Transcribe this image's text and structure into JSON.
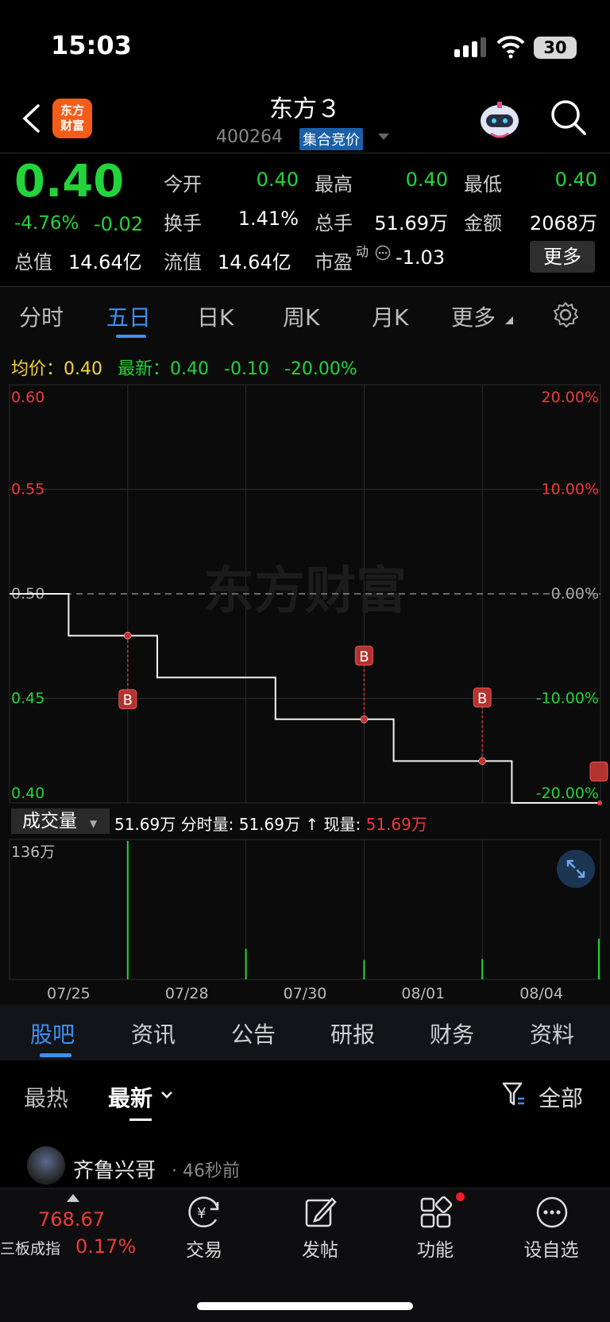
{
  "status": {
    "time": "15:03",
    "battery": "30"
  },
  "header": {
    "logo_line1": "东方",
    "logo_line2": "财富",
    "title": "东方３",
    "code": "400264",
    "badge": "集合竞价"
  },
  "quote": {
    "price": "0.40",
    "change_pct": "-4.76%",
    "change": "-0.02",
    "total_value_label": "总值",
    "total_value": "14.64亿",
    "rows": [
      [
        {
          "label": "今开",
          "value": "0.40",
          "color": "green"
        },
        {
          "label": "最高",
          "value": "0.40",
          "color": "green"
        },
        {
          "label": "最低",
          "value": "0.40",
          "color": "green"
        }
      ],
      [
        {
          "label": "换手",
          "value": "1.41%",
          "color": "white"
        },
        {
          "label": "总手",
          "value": "51.69万",
          "color": "white"
        },
        {
          "label": "金额",
          "value": "2068万",
          "color": "white"
        }
      ]
    ],
    "float_label": "流值",
    "float_value": "14.64亿",
    "pe_label": "市盈",
    "pe_sup": "动",
    "pe_value": "-1.03",
    "more_button": "更多"
  },
  "chart_tabs": [
    "分时",
    "五日",
    "日K",
    "周K",
    "月K",
    "更多"
  ],
  "chart_header": {
    "avg_label": "均价：",
    "avg_value": "0.40",
    "latest_label": "最新：",
    "latest_value": "0.40",
    "latest_change": "-0.10",
    "latest_pct": "-20.00%"
  },
  "chart_data": {
    "type": "line",
    "title": "",
    "x_tick_labels": [
      "07/25",
      "07/28",
      "07/30",
      "08/01",
      "08/04"
    ],
    "y_tick_labels": [
      "0.60",
      "0.55",
      "0.50",
      "0.45",
      "0.40"
    ],
    "y_right_labels": [
      "20.00%",
      "10.00%",
      "0.00%",
      "-10.00%",
      "-20.00%"
    ],
    "ylim": [
      0.4,
      0.6
    ],
    "prev_close": 0.5,
    "series": [
      {
        "x": [
          0,
          0.5,
          0.5,
          1.25,
          1.25,
          2.25,
          2.25,
          3.25,
          3.25,
          4.25,
          4.25,
          5.0
        ],
        "y": [
          0.5,
          0.5,
          0.48,
          0.48,
          0.46,
          0.46,
          0.44,
          0.44,
          0.42,
          0.42,
          0.4,
          0.4
        ]
      }
    ],
    "markers": [
      {
        "x": 1.0,
        "y": 0.48,
        "label": "B",
        "side": "below"
      },
      {
        "x": 3.0,
        "y": 0.44,
        "label": "B",
        "side": "above"
      },
      {
        "x": 4.0,
        "y": 0.42,
        "label": "B",
        "side": "above"
      }
    ],
    "volume": {
      "label": "成交量",
      "summary": "51.69万",
      "fen_label": "分时量:",
      "fen_value": "51.69万",
      "now_label": "现量:",
      "now_value": "51.69万",
      "max_label": "136万",
      "max": 136,
      "bars": [
        {
          "x": 1.0,
          "v": 136
        },
        {
          "x": 2.0,
          "v": 30
        },
        {
          "x": 3.0,
          "v": 19
        },
        {
          "x": 4.0,
          "v": 20
        },
        {
          "x": 5.0,
          "v": 40
        }
      ]
    },
    "watermark": "东方财富"
  },
  "guba_tabs": [
    "股吧",
    "资讯",
    "公告",
    "研报",
    "财务",
    "资料"
  ],
  "sub_tabs": {
    "hot": "最热",
    "latest": "最新",
    "filter": "全部"
  },
  "post": {
    "user": "齐鲁兴哥",
    "time": "46秒前"
  },
  "bottom": {
    "index_value": "768.67",
    "index_name": "三板成指",
    "index_pct": "0.17%",
    "items": [
      "交易",
      "发帖",
      "功能",
      "设自选"
    ]
  }
}
